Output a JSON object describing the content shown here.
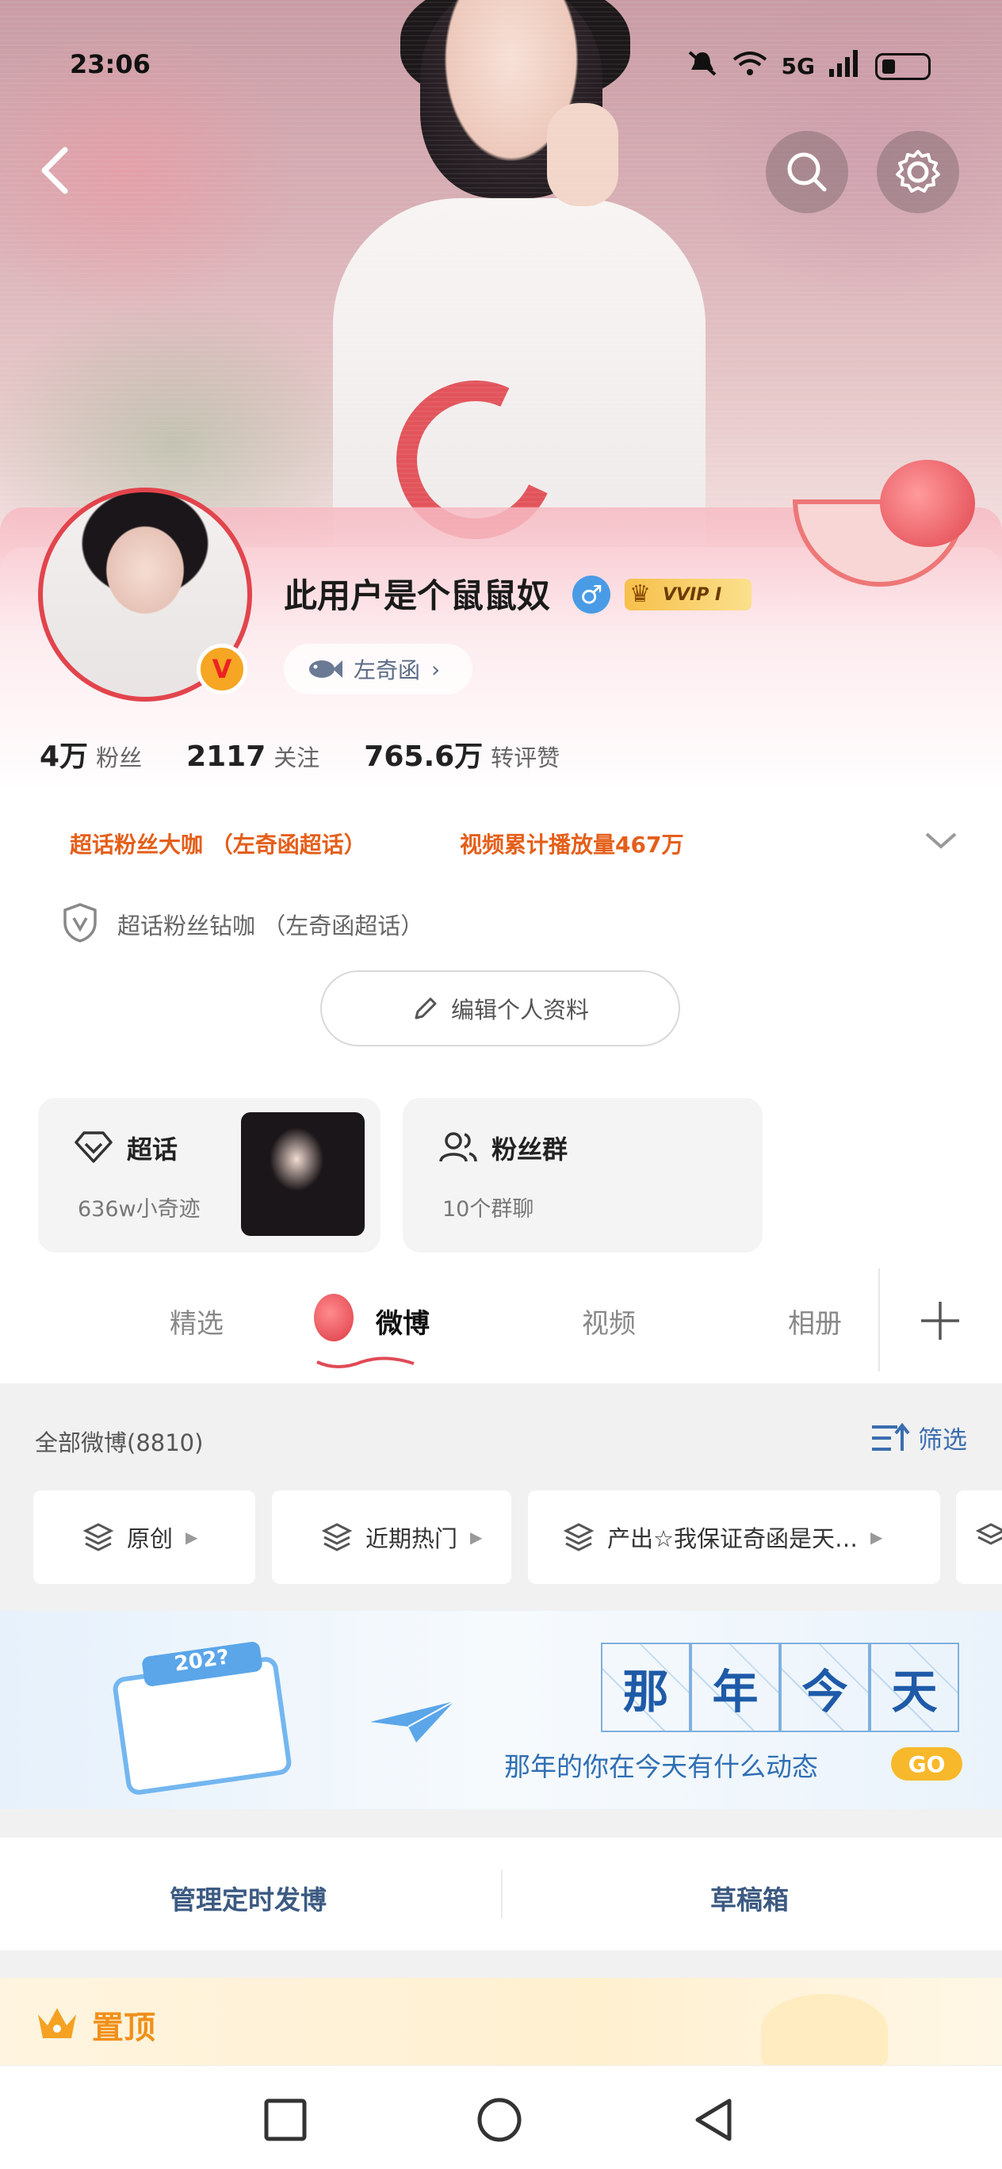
{
  "status_bar": {
    "time": "23:06",
    "network": "5G"
  },
  "profile": {
    "username": "此用户是个鼠鼠奴",
    "gender_symbol": "♂",
    "vip_badge": "VVIP I",
    "verified_badge": "V",
    "topic_chip": "左奇函"
  },
  "stats": [
    {
      "value": "4万",
      "label": "粉丝"
    },
    {
      "value": "2117",
      "label": "关注"
    },
    {
      "value": "765.6万",
      "label": "转评赞"
    }
  ],
  "honors": {
    "line1": "超话粉丝大咖 （左奇函超话）",
    "line2": "视频累计播放量467万",
    "line3": "超话粉丝钻咖 （左奇函超话）"
  },
  "edit_button": "编辑个人资料",
  "cards": {
    "topic": {
      "title": "超话",
      "sub": "636w小奇迹"
    },
    "fans": {
      "title": "粉丝群",
      "sub": "10个群聊"
    }
  },
  "tabs": [
    {
      "label": "精选"
    },
    {
      "label": "微博"
    },
    {
      "label": "视频"
    },
    {
      "label": "相册"
    }
  ],
  "feed": {
    "count_label": "全部微博(8810)",
    "filter_label": "筛选",
    "chips": [
      {
        "label": "原创"
      },
      {
        "label": "近期热门"
      },
      {
        "label": "产出☆我保证奇函是天…"
      }
    ]
  },
  "banner": {
    "calendar_year": "202?",
    "grid_chars": [
      "那",
      "年",
      "今",
      "天"
    ],
    "subtitle": "那年的你在今天有什么动态",
    "go": "GO"
  },
  "manage": {
    "scheduled": "管理定时发博",
    "drafts": "草稿箱"
  },
  "pinned": {
    "label": "置顶"
  },
  "colors": {
    "accent_orange": "#e45f1a",
    "link_blue": "#3a6db0",
    "gender_blue": "#4a9be5",
    "vip_gold": "#f7c04a"
  }
}
